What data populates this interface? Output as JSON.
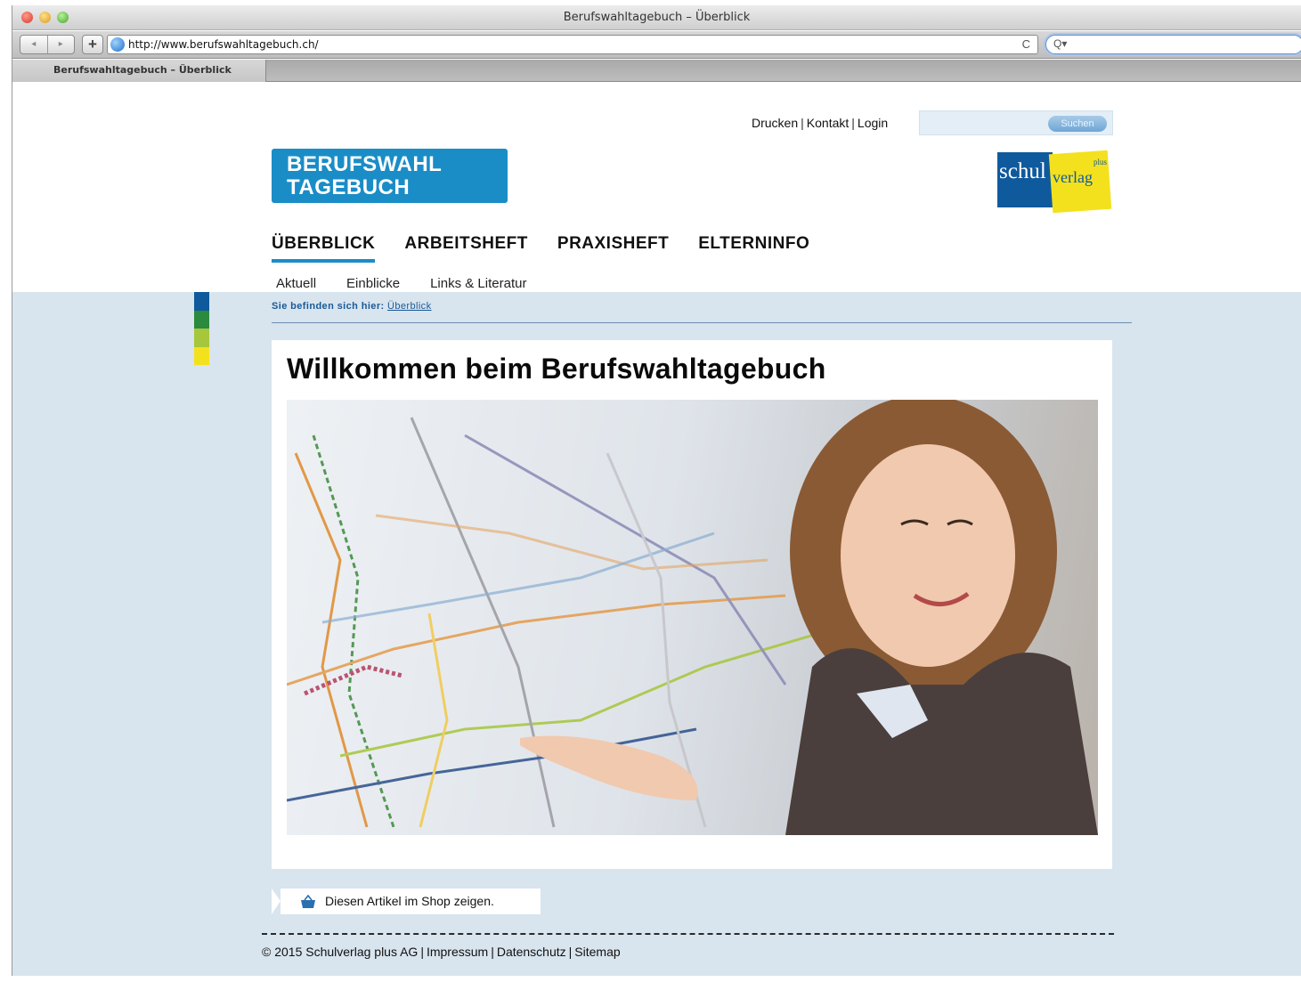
{
  "browser": {
    "window_title": "Berufswahltagebuch – Überblick",
    "url": "http://www.berufswahltagebuch.ch/",
    "tab_title": "Berufswahltagebuch – Überblick",
    "back_icon": "◂",
    "forward_icon": "▸",
    "add_icon": "+",
    "reload_icon": "C",
    "search_icon": "Q▾"
  },
  "header": {
    "util_links": [
      "Drucken",
      "Kontakt",
      "Login"
    ],
    "separator": "|",
    "search_placeholder": "",
    "search_button": "Suchen",
    "logo_line1": "BERUFSWAHL",
    "logo_line2": "TAGEBUCH",
    "publisher_logo": {
      "part1": "schul",
      "part2": "verlag",
      "part3": "plus"
    }
  },
  "nav": {
    "main": [
      {
        "label": "ÜBERBLICK",
        "active": true
      },
      {
        "label": "ARBEITSHEFT",
        "active": false
      },
      {
        "label": "PRAXISHEFT",
        "active": false
      },
      {
        "label": "ELTERNINFO",
        "active": false
      }
    ],
    "sub": [
      "Aktuell",
      "Einblicke",
      "Links & Literatur"
    ]
  },
  "breadcrumb": {
    "prefix": "Sie befinden sich hier:",
    "current": "Überblick"
  },
  "content": {
    "title": "Willkommen beim Berufswahltagebuch",
    "hero_icon": "photo-young-woman-pointing-at-transit-map"
  },
  "shop": {
    "label": "Diesen Artikel im Shop zeigen."
  },
  "footer": {
    "copyright": "© 2015 Schulverlag plus AG",
    "links": [
      "Impressum",
      "Datenschutz",
      "Sitemap"
    ]
  },
  "colors": {
    "brand_blue": "#1a8dc7",
    "publisher_blue": "#0f5a9c",
    "publisher_yellow": "#f4e11d",
    "page_background": "#d8e4ee",
    "side_bar": [
      "#0f5a9c",
      "#2a8a3e",
      "#a6c63b",
      "#f4e11d"
    ]
  }
}
